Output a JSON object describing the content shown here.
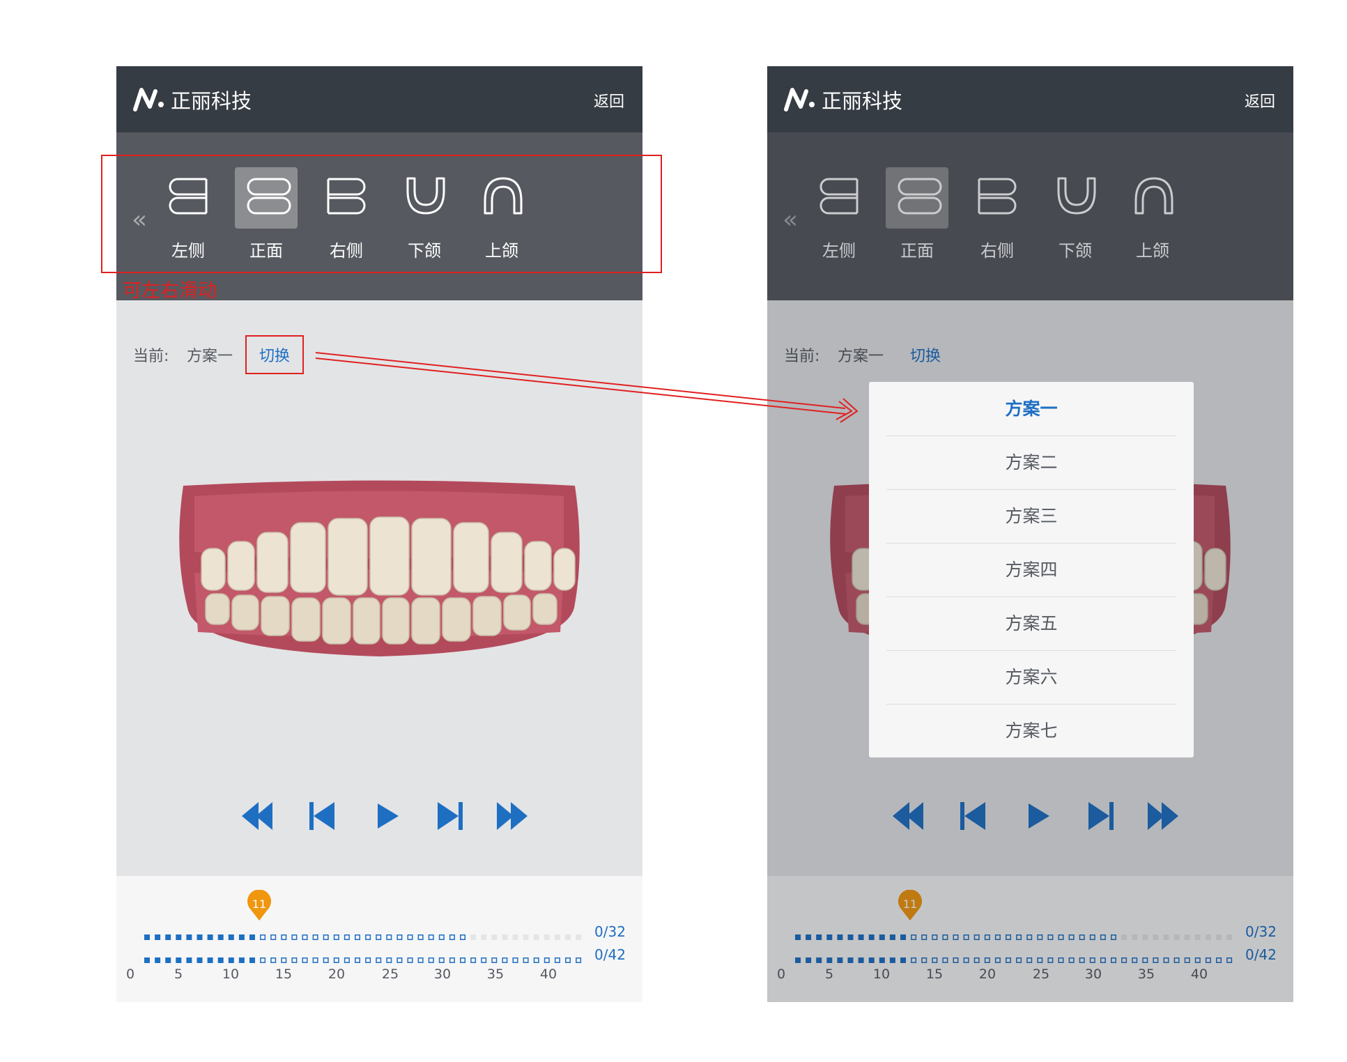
{
  "brand": {
    "name": "正丽科技"
  },
  "header": {
    "back_label": "返回"
  },
  "views": [
    {
      "label": "左侧",
      "icon": "left-side-icon",
      "active": false
    },
    {
      "label": "正面",
      "icon": "front-icon",
      "active": true
    },
    {
      "label": "右侧",
      "icon": "right-side-icon",
      "active": false
    },
    {
      "label": "下颌",
      "icon": "lower-jaw-icon",
      "active": false
    },
    {
      "label": "上颌",
      "icon": "upper-jaw-icon",
      "active": false
    }
  ],
  "annotation": {
    "swipe_hint": "可左右滑动"
  },
  "plan": {
    "current_label": "当前:",
    "current_value": "方案一",
    "switch_label": "切换"
  },
  "player": {
    "buttons": [
      "fast-rewind-icon",
      "skip-previous-icon",
      "play-icon",
      "skip-next-icon",
      "fast-forward-icon"
    ]
  },
  "progress": {
    "marker": "11",
    "upper_count": "0/32",
    "lower_count": "0/42",
    "axis": [
      "0",
      "5",
      "10",
      "15",
      "20",
      "25",
      "30",
      "35",
      "40"
    ]
  },
  "dropdown": {
    "items": [
      "方案一",
      "方案二",
      "方案三",
      "方案四",
      "方案五",
      "方案六",
      "方案七"
    ],
    "selected_index": 0
  },
  "colors": {
    "accent": "#1e6fc2",
    "marker": "#f0960f",
    "annotation": "#e02020",
    "topbar": "#363c44"
  }
}
